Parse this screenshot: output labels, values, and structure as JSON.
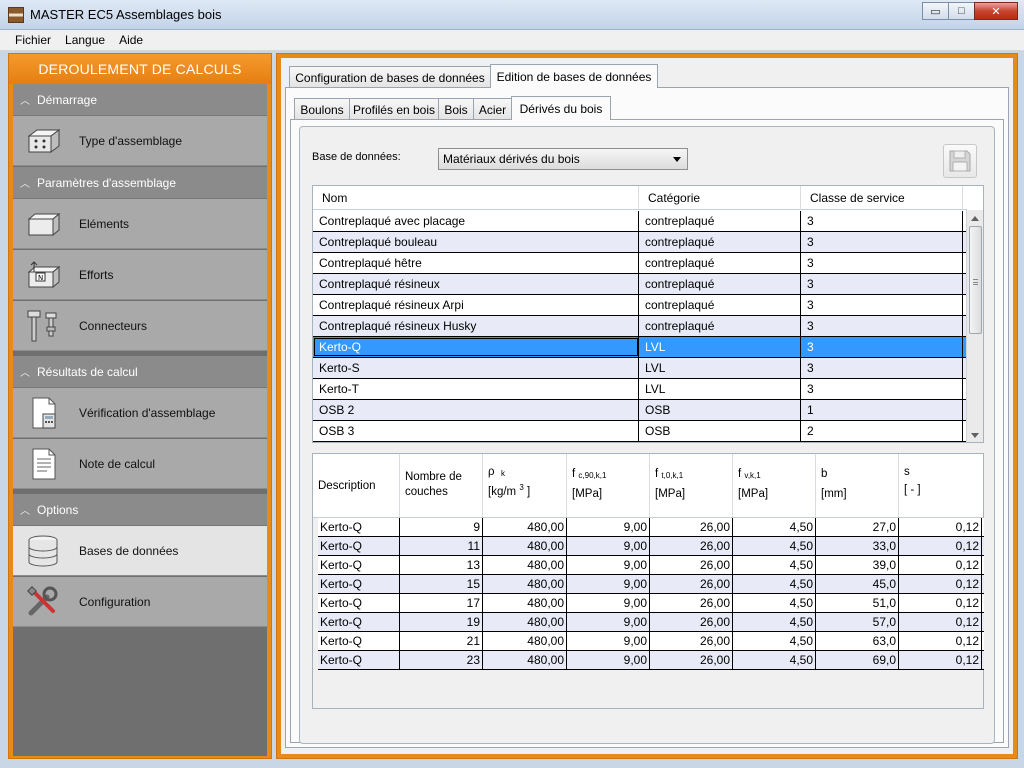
{
  "window": {
    "title": "MASTER EC5 Assemblages bois",
    "buttons": {
      "minimize": "▭",
      "maximize": "□",
      "close": "✕"
    }
  },
  "menu": [
    {
      "label": "Fichier"
    },
    {
      "label": "Langue"
    },
    {
      "label": "Aide"
    }
  ],
  "sidebar": {
    "header": "DEROULEMENT DE CALCULS",
    "sections": [
      {
        "label": "Démarrage"
      },
      {
        "label": "Paramètres d'assemblage"
      },
      {
        "label": "Résultats de calcul"
      },
      {
        "label": "Options"
      }
    ],
    "items": [
      {
        "label": "Type d'assemblage"
      },
      {
        "label": "Eléments"
      },
      {
        "label": "Efforts"
      },
      {
        "label": "Connecteurs"
      },
      {
        "label": "Vérification d'assemblage"
      },
      {
        "label": "Note de calcul"
      },
      {
        "label": "Bases de données"
      },
      {
        "label": "Configuration"
      }
    ]
  },
  "tabs_top": [
    "Configuration de bases de données",
    "Edition de bases de données"
  ],
  "tabs_sub": [
    "Boulons",
    "Profilés en bois",
    "Bois",
    "Acier",
    "Dérivés du bois"
  ],
  "database": {
    "label": "Base de données:",
    "selected": "Matériaux dérivés du bois"
  },
  "materials_grid": {
    "headers": [
      "Nom",
      "Catégorie",
      "Classe de service"
    ],
    "rows": [
      [
        "Contreplaqué avec placage",
        "contreplaqué",
        "3"
      ],
      [
        "Contreplaqué bouleau",
        "contreplaqué",
        "3"
      ],
      [
        "Contreplaqué hêtre",
        "contreplaqué",
        "3"
      ],
      [
        "Contreplaqué résineux",
        "contreplaqué",
        "3"
      ],
      [
        "Contreplaqué résineux Arpi",
        "contreplaqué",
        "3"
      ],
      [
        "Contreplaqué résineux Husky",
        "contreplaqué",
        "3"
      ],
      [
        "Kerto-Q",
        "LVL",
        "3"
      ],
      [
        "Kerto-S",
        "LVL",
        "3"
      ],
      [
        "Kerto-T",
        "LVL",
        "3"
      ],
      [
        "OSB 2",
        "OSB",
        "1"
      ],
      [
        "OSB 3",
        "OSB",
        "2"
      ]
    ],
    "selected_index": 6
  },
  "properties_grid": {
    "headers": {
      "description": "Description",
      "layers": "Nombre de couches",
      "rho": {
        "sym": "ρ",
        "sub": "k",
        "unit": "[kg/m",
        "unit_sup": "3",
        "unit_end": "]"
      },
      "fc90": {
        "sym": "f",
        "sub": "c,90,k,1",
        "unit": "[MPa]"
      },
      "ft0": {
        "sym": "f",
        "sub": "t,0,k,1",
        "unit": "[MPa]"
      },
      "fv": {
        "sym": "f",
        "sub": "v,k,1",
        "unit": "[MPa]"
      },
      "b": {
        "sym": "b",
        "unit": "[mm]"
      },
      "s": {
        "sym": "s",
        "unit": "[ - ]"
      }
    },
    "rows": [
      [
        "Kerto-Q",
        "9",
        "480,00",
        "9,00",
        "26,00",
        "4,50",
        "27,0",
        "0,12"
      ],
      [
        "Kerto-Q",
        "11",
        "480,00",
        "9,00",
        "26,00",
        "4,50",
        "33,0",
        "0,12"
      ],
      [
        "Kerto-Q",
        "13",
        "480,00",
        "9,00",
        "26,00",
        "4,50",
        "39,0",
        "0,12"
      ],
      [
        "Kerto-Q",
        "15",
        "480,00",
        "9,00",
        "26,00",
        "4,50",
        "45,0",
        "0,12"
      ],
      [
        "Kerto-Q",
        "17",
        "480,00",
        "9,00",
        "26,00",
        "4,50",
        "51,0",
        "0,12"
      ],
      [
        "Kerto-Q",
        "19",
        "480,00",
        "9,00",
        "26,00",
        "4,50",
        "57,0",
        "0,12"
      ],
      [
        "Kerto-Q",
        "21",
        "480,00",
        "9,00",
        "26,00",
        "4,50",
        "63,0",
        "0,12"
      ],
      [
        "Kerto-Q",
        "23",
        "480,00",
        "9,00",
        "26,00",
        "4,50",
        "69,0",
        "0,12"
      ]
    ]
  },
  "colors": {
    "accent": "#e78a17",
    "selection": "#3399ff",
    "alt_row": "#e8eaf7",
    "sidebar_item": "#a9a9a9"
  }
}
